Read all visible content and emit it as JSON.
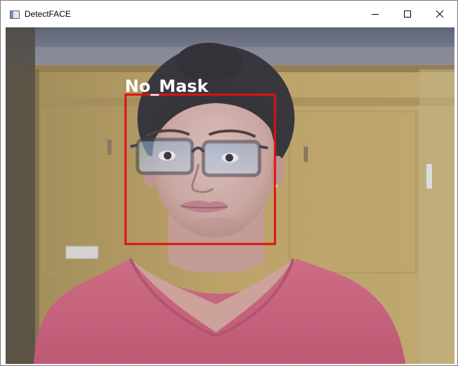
{
  "window": {
    "title": "DetectFACE",
    "icons": {
      "app": "app-window-icon",
      "minimize": "minimize-icon",
      "maximize": "maximize-icon",
      "close": "close-icon"
    }
  },
  "detection": {
    "label": "No_Mask",
    "box_color": "#e01010",
    "label_color": "#ffffff"
  }
}
